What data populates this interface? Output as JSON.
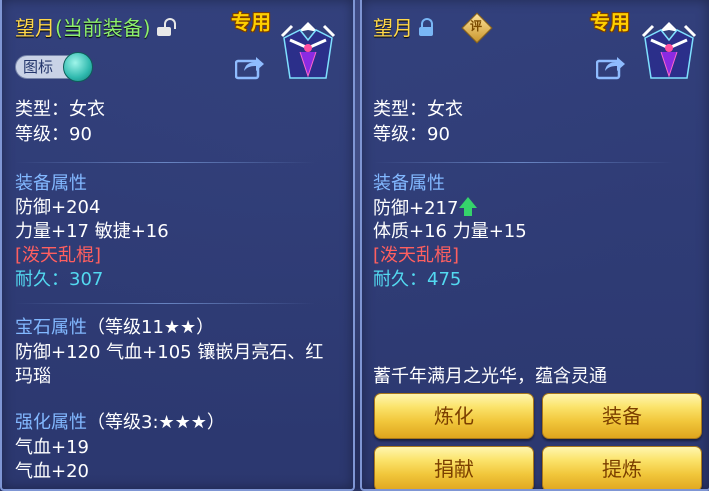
{
  "left": {
    "title_name": "望月",
    "title_status": "(当前装备)",
    "badge": "专用",
    "toggle_label": "图标",
    "type_line": "类型：女衣",
    "level_line": "等级：90",
    "attr_heading": "装备属性",
    "defense": "防御+204",
    "stats": "力量+17 敏捷+16",
    "special": "[泼天乱棍]",
    "durability_label": "耐久：",
    "durability_value": "307",
    "gem_heading": "宝石属性",
    "gem_level": "（等级11★★）",
    "gem_line1": "防御+120 气血+105 镶嵌月亮石、红",
    "gem_line2": "玛瑙",
    "enhance_heading": "强化属性",
    "enhance_level": "（等级3:★★★）",
    "enhance_line1": "气血+19",
    "enhance_line2": "气血+20"
  },
  "right": {
    "title_name": "望月",
    "badge": "专用",
    "rate_icon_char": "评",
    "type_line": "类型：女衣",
    "level_line": "等级：90",
    "attr_heading": "装备属性",
    "defense": "防御+217",
    "stats": "体质+16 力量+15",
    "special": "[泼天乱棍]",
    "durability_label": "耐久：",
    "durability_value": "475",
    "description": "蓄千年满月之光华，蕴含灵通",
    "buttons": {
      "refine": "炼化",
      "equip": "装备",
      "donate": "捐献",
      "extract": "提炼"
    }
  },
  "colors": {
    "title": "#ffd84a",
    "current_equip": "#8df06c",
    "section_heading": "#82b8ff",
    "special_skill": "#ff5f5f",
    "durability": "#53d9f0",
    "stat_up_arrow": "#35d36b",
    "button_text": "#7b3f00"
  },
  "icons": {
    "left_lock": "lock-open-icon",
    "right_lock": "lock-closed-icon",
    "share": "share-icon",
    "rate": "rate-icon",
    "stat_up": "arrow-up-icon",
    "portrait": "robe-portrait-icon"
  }
}
